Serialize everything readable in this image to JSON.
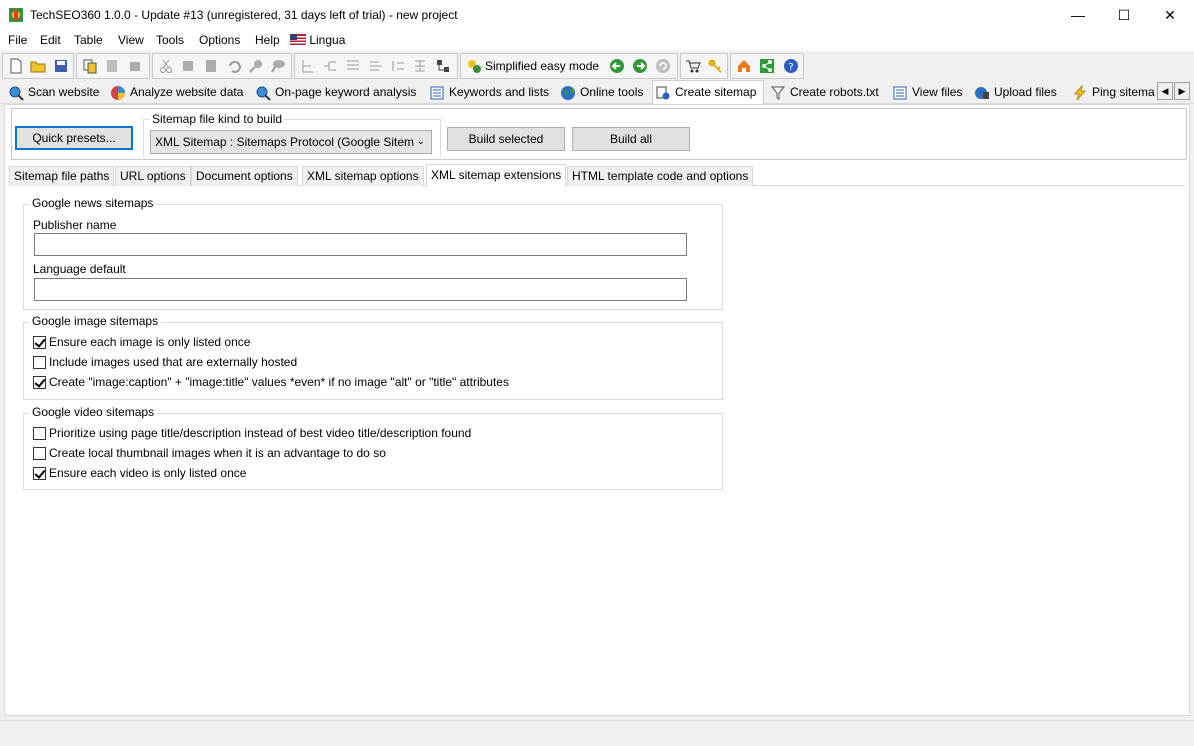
{
  "window": {
    "title": "TechSEO360 1.0.0 - Update #13 (unregistered, 31 days left of trial) - new project",
    "minimize": "—",
    "maximize": "☐",
    "close": "✕"
  },
  "menu": {
    "items": [
      "File",
      "Edit",
      "Table",
      "View",
      "Tools",
      "Options",
      "Help",
      "Lingua"
    ]
  },
  "toolbar": {
    "simplified_label": "Simplified easy mode"
  },
  "nav_tabs": [
    {
      "label": "Scan website",
      "icon": "magnifier-icon"
    },
    {
      "label": "Analyze website data",
      "icon": "pie-chart-icon"
    },
    {
      "label": "On-page keyword analysis",
      "icon": "magnifier-icon"
    },
    {
      "label": "Keywords and lists",
      "icon": "list-icon"
    },
    {
      "label": "Online tools",
      "icon": "globe-icon"
    },
    {
      "label": "Create sitemap",
      "icon": "sitemap-icon"
    },
    {
      "label": "Create robots.txt",
      "icon": "filter-icon"
    },
    {
      "label": "View files",
      "icon": "list-icon"
    },
    {
      "label": "Upload files",
      "icon": "upload-icon"
    },
    {
      "label": "Ping sitema",
      "icon": "lightning-icon"
    }
  ],
  "top_panel": {
    "quick_presets": "Quick presets...",
    "sitemap_kind_label": "Sitemap file kind to build",
    "sitemap_kind_value": "XML Sitemap : Sitemaps Protocol (Google Sitem",
    "build_selected": "Build selected",
    "build_all": "Build all"
  },
  "sub_tabs": [
    "Sitemap file paths",
    "URL options",
    "Document options",
    "XML sitemap options",
    "XML sitemap extensions",
    "HTML template code and options"
  ],
  "news": {
    "legend": "Google news sitemaps",
    "publisher_label": "Publisher name",
    "publisher_value": "",
    "language_label": "Language default",
    "language_value": ""
  },
  "image": {
    "legend": "Google image sitemaps",
    "options": [
      {
        "label": "Ensure each image is only listed once",
        "checked": true
      },
      {
        "label": "Include images used that are externally hosted",
        "checked": false
      },
      {
        "label": "Create \"image:caption\" + \"image:title\" values *even* if no image \"alt\" or \"title\" attributes",
        "checked": true
      }
    ]
  },
  "video": {
    "legend": "Google video sitemaps",
    "options": [
      {
        "label": "Prioritize using page title/description instead of best video title/description found",
        "checked": false
      },
      {
        "label": "Create local thumbnail images when it is an advantage to do so",
        "checked": false
      },
      {
        "label": "Ensure each video is only listed once",
        "checked": true
      }
    ]
  },
  "colors": {
    "accent": "#0078d7",
    "window_bg": "#f0f0f0"
  }
}
